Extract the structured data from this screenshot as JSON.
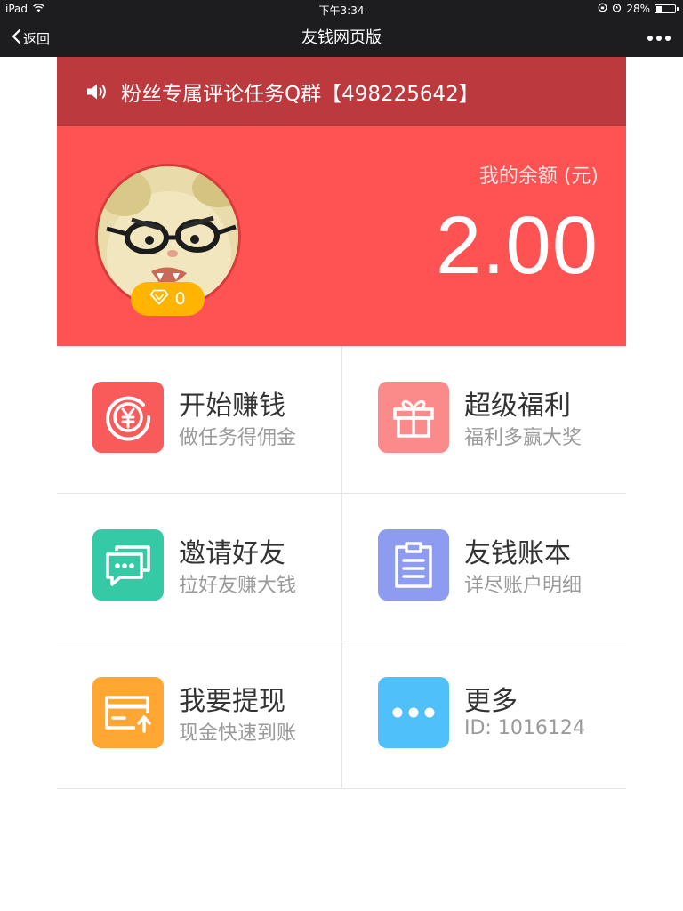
{
  "status_bar": {
    "device": "iPad",
    "time": "下午3:34",
    "battery": "28%",
    "battery_level": 0.28
  },
  "nav": {
    "back_label": "返回",
    "title": "友钱网页版"
  },
  "notice": {
    "text": "粉丝专属评论任务Q群【498225642】"
  },
  "account": {
    "diamond_count": "0",
    "balance_label": "我的余额 (元)",
    "balance": "2.00"
  },
  "menu": [
    {
      "title": "开始赚钱",
      "subtitle": "做任务得佣金",
      "icon": "yen-coin-icon",
      "color": "#f95a5a"
    },
    {
      "title": "超级福利",
      "subtitle": "福利多赢大奖",
      "icon": "gift-icon",
      "color": "#fb8a8a"
    },
    {
      "title": "邀请好友",
      "subtitle": "拉好友赚大钱",
      "icon": "chat-bubbles-icon",
      "color": "#36c9a6"
    },
    {
      "title": "友钱账本",
      "subtitle": "详尽账户明细",
      "icon": "clipboard-icon",
      "color": "#8d9cf0"
    },
    {
      "title": "我要提现",
      "subtitle": "现金快速到账",
      "icon": "card-withdraw-icon",
      "color": "#ffa633"
    },
    {
      "title": "更多",
      "subtitle": "ID: 1016124",
      "icon": "more-dots-icon",
      "color": "#4fc0fa"
    }
  ]
}
